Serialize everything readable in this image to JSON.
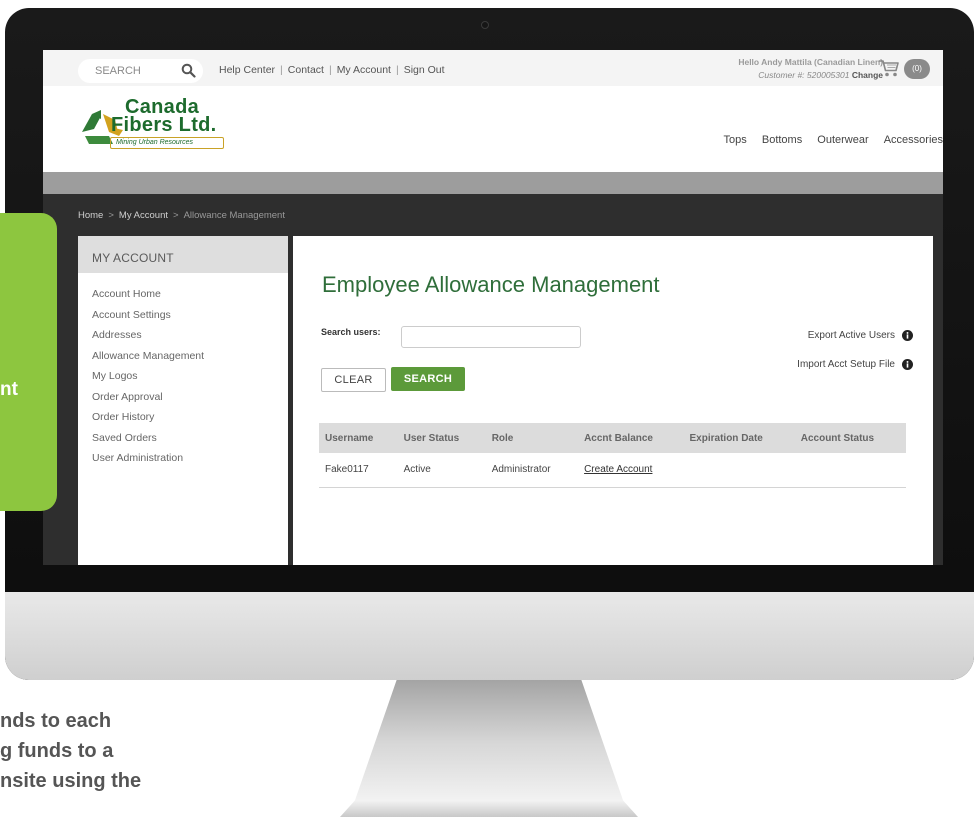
{
  "topbar": {
    "search_placeholder": "SEARCH",
    "links": [
      "Help Center",
      "Contact",
      "My Account",
      "Sign Out"
    ],
    "greeting": "Hello Andy Mattila (Canadian Linen)",
    "customer_label": "Customer #: 520005301",
    "change_label": "Change",
    "cart_count": "(0)"
  },
  "logo": {
    "line1": "Canada",
    "line2": "Fibers Ltd.",
    "tagline": "Mining Urban Resources"
  },
  "nav": {
    "categories": [
      "Tops",
      "Bottoms",
      "Outerwear",
      "Accessories"
    ]
  },
  "breadcrumb": [
    "Home",
    "My Account",
    "Allowance Management"
  ],
  "sidebar": {
    "title": "MY ACCOUNT",
    "items": [
      "Account Home",
      "Account Settings",
      "Addresses",
      "Allowance Management",
      "My Logos",
      "Order Approval",
      "Order History",
      "Saved Orders",
      "User Administration"
    ]
  },
  "main": {
    "title": "Employee Allowance Management",
    "search_label": "Search users:",
    "search_value": "",
    "clear_label": "CLEAR",
    "search_label_btn": "SEARCH",
    "export_label": "Export Active Users",
    "import_label": "Import Acct Setup File"
  },
  "table": {
    "headers": [
      "Username",
      "User Status",
      "Role",
      "Accnt Balance",
      "Expiration Date",
      "Account Status"
    ],
    "rows": [
      [
        "Fake0117",
        "Active",
        "Administrator",
        "Create Account",
        "",
        ""
      ]
    ]
  },
  "callout": {
    "text": "nt"
  },
  "caption": {
    "lines": [
      "nds to each",
      "g funds to a",
      "nsite using the"
    ]
  },
  "colors": {
    "brand_green": "#2f6e3a",
    "button_green": "#5c9a3a",
    "callout_green": "#8dc63f"
  },
  "icons": [
    "search-icon",
    "cart-icon",
    "info-icon",
    "recycle-logo-icon"
  ]
}
